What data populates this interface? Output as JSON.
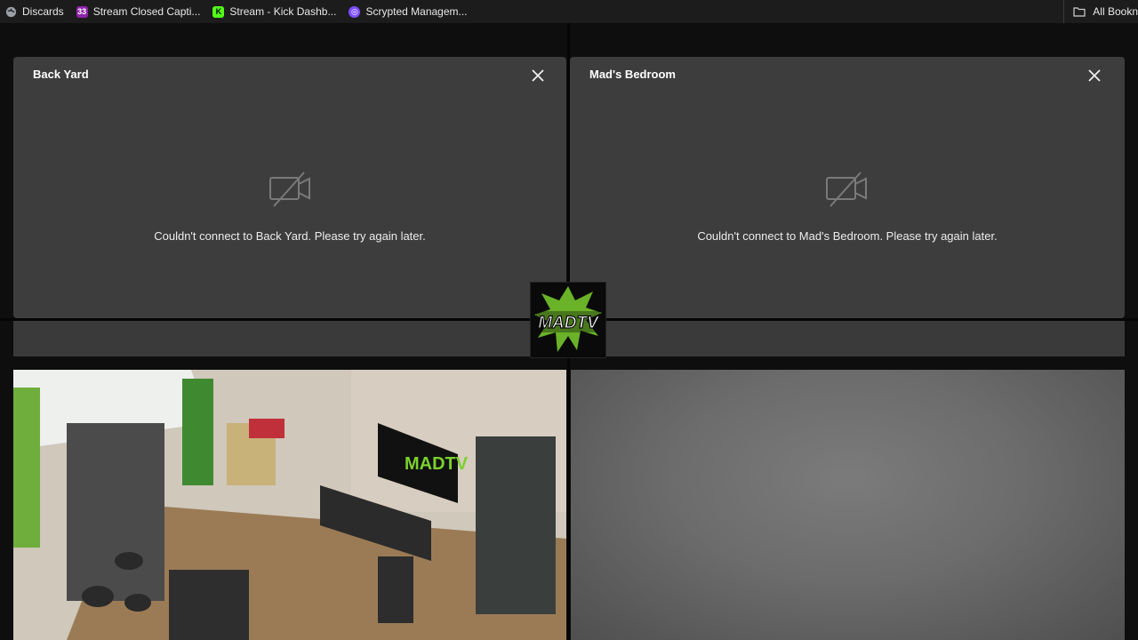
{
  "bookmarks": {
    "items": [
      {
        "label": "Discards",
        "icon": "globe-icon",
        "color": "#9aa0a6"
      },
      {
        "label": "Stream Closed Capti...",
        "icon": "captions-app-icon",
        "color": "#8e24aa"
      },
      {
        "label": "Stream - Kick Dashb...",
        "icon": "kick-icon",
        "color": "#53fc18"
      },
      {
        "label": "Scrypted Managem...",
        "icon": "scrypted-icon",
        "color": "#7c4dff"
      }
    ],
    "all_bookmarks": "All Bookn"
  },
  "cameras": {
    "back_yard": {
      "title": "Back Yard",
      "error": "Couldn't connect to Back Yard. Please try again later."
    },
    "mads_bedroom": {
      "title": "Mad's Bedroom",
      "error": "Couldn't connect to Mad's Bedroom. Please try again later."
    }
  },
  "logo": {
    "text": "MADTV",
    "colors": {
      "green": "#7bd12e",
      "bg": "#0a0a0a"
    }
  },
  "colors": {
    "panel": "#3d3d3d",
    "background": "#0e0e0e"
  }
}
